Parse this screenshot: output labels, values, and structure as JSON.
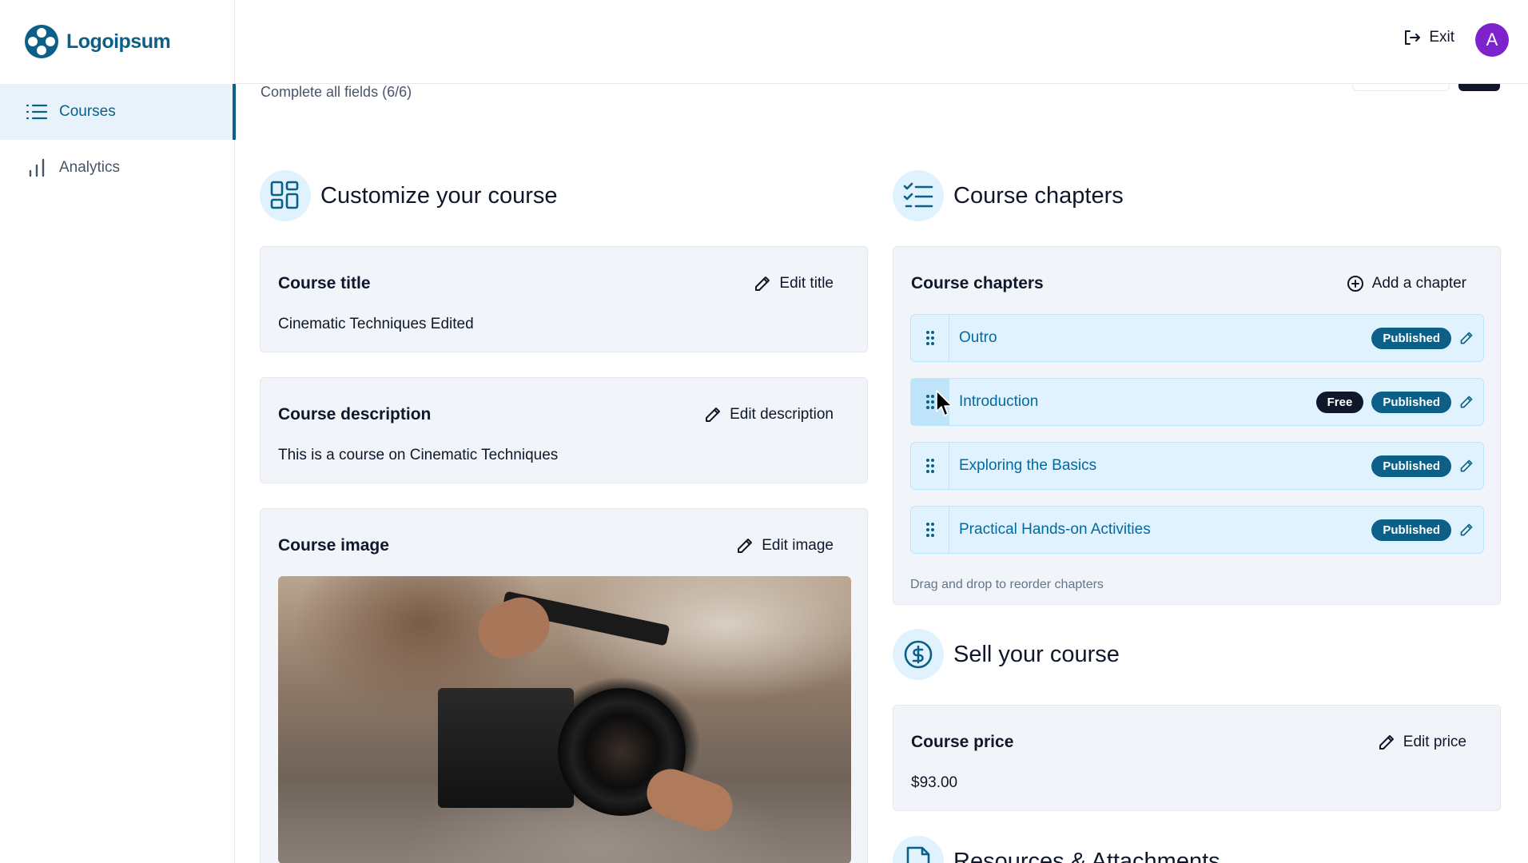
{
  "brand": {
    "name": "Logoipsum",
    "color": "#0c5f86"
  },
  "sidebar": {
    "items": [
      {
        "label": "Courses",
        "icon": "list-icon",
        "active": true
      },
      {
        "label": "Analytics",
        "icon": "bar-chart-icon",
        "active": false
      }
    ]
  },
  "topbar": {
    "exit_label": "Exit",
    "avatar_initial": "A"
  },
  "progress": {
    "text": "Complete all fields (6/6)"
  },
  "customize": {
    "heading": "Customize your course",
    "title_card": {
      "title": "Course title",
      "action": "Edit title",
      "value": "Cinematic Techniques Edited"
    },
    "description_card": {
      "title": "Course description",
      "action": "Edit description",
      "value": "This is a course on Cinematic Techniques"
    },
    "image_card": {
      "title": "Course image",
      "action": "Edit image"
    }
  },
  "chapters": {
    "heading": "Course chapters",
    "card_title": "Course chapters",
    "add_action": "Add a chapter",
    "items": [
      {
        "name": "Outro",
        "free": false,
        "status": "Published"
      },
      {
        "name": "Introduction",
        "free": true,
        "free_label": "Free",
        "status": "Published"
      },
      {
        "name": "Exploring the Basics",
        "free": false,
        "status": "Published"
      },
      {
        "name": "Practical Hands-on Activities",
        "free": false,
        "status": "Published"
      }
    ],
    "hint": "Drag and drop to reorder chapters"
  },
  "sell": {
    "heading": "Sell your course",
    "price_card": {
      "title": "Course price",
      "action": "Edit price",
      "value": "$93.00"
    }
  },
  "resources": {
    "heading": "Resources & Attachments"
  }
}
